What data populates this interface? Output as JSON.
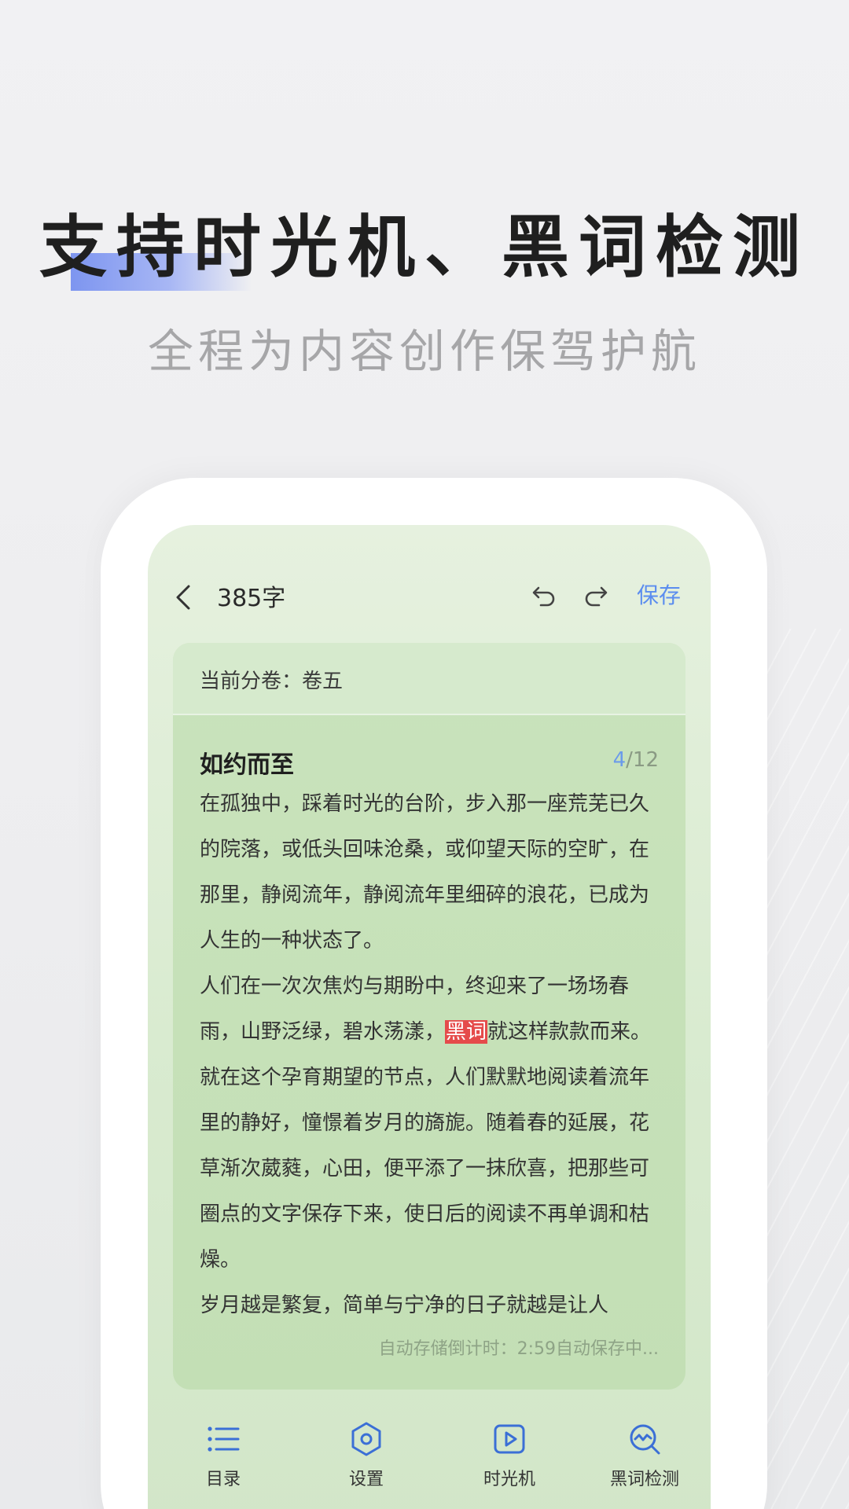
{
  "promo": {
    "headline": "支持时光机、黑词检测",
    "subheadline": "全程为内容创作保驾护航"
  },
  "editor": {
    "word_count": "385字",
    "save_label": "保存",
    "volume_label": "当前分卷：卷五",
    "chapter_title": "如约而至",
    "chapter_current": "4",
    "chapter_total": "/12",
    "paragraphs": [
      "在孤独中，踩着时光的台阶，步入那一座荒芜已久的院落，或低头回味沧桑，或仰望天际的空旷，在那里，静阅流年，静阅流年里细碎的浪花，已成为人生的一种状态了。",
      "人们在一次次焦灼与期盼中，终迎来了一场场春雨，山野泛绿，碧水荡漾，",
      "黑词",
      "就这样款款而来。就在这个孕育期望的节点，人们默默地阅读着流年里的静好，憧憬着岁月的旖旎。随着春的延展，花草渐次葳蕤，心田，便平添了一抹欣喜，把那些可圈点的文字保存下来，使日后的阅读不再单调和枯燥。",
      "岁月越是繁复，简单与宁净的日子就越是让人"
    ],
    "autosave_text": "自动存储倒计时：2:59自动保存中..."
  },
  "bottom_nav": [
    {
      "label": "目录",
      "icon": "list-icon"
    },
    {
      "label": "设置",
      "icon": "settings-hexagon-icon"
    },
    {
      "label": "时光机",
      "icon": "play-icon"
    },
    {
      "label": "黑词检测",
      "icon": "detect-icon"
    }
  ],
  "colors": {
    "accent": "#5b8def",
    "highlight": "#e54b4b",
    "card_green": "#c9e3bc"
  }
}
